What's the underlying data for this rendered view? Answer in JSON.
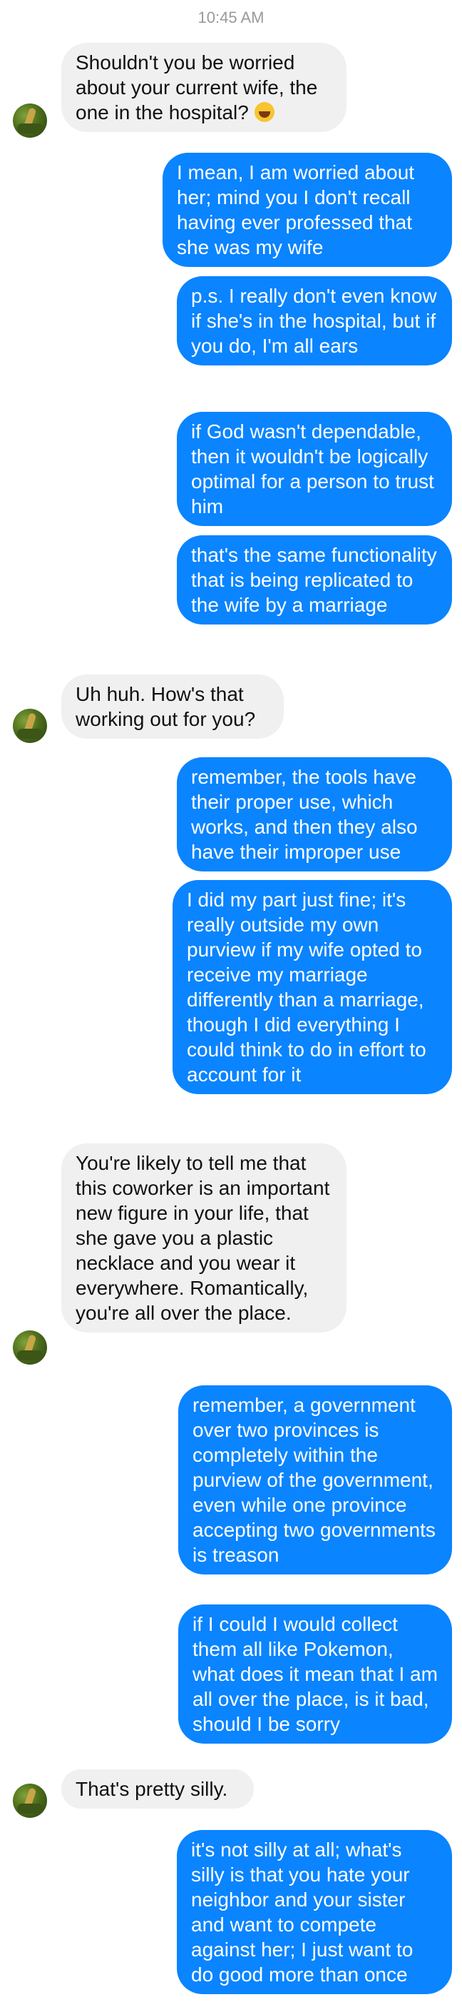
{
  "timestamp": "10:45 AM",
  "messages": [
    {
      "text": "Shouldn't you be worried about your current wife, the one in the hospital?",
      "emoji": "laughing-face-emoji"
    },
    {
      "text": "I mean, I am worried about her; mind you I don't recall having ever professed that she was my wife"
    },
    {
      "text": "p.s. I really don't even know if she's in the hospital, but if you do, I'm all ears"
    },
    {
      "text": "if God wasn't dependable, then it wouldn't be logically optimal for a person to trust him"
    },
    {
      "text": "that's the same functionality that is being replicated to the wife by a marriage"
    },
    {
      "text": "Uh huh. How's that working out for you?"
    },
    {
      "text": "remember, the tools have their proper use, which works, and then they also have their improper use"
    },
    {
      "text": "I did my part just fine; it's really outside my own purview if my wife opted to receive my marriage differently than a marriage, though I did everything I could think to do in effort to account for it"
    },
    {
      "text": "You're likely to tell me that this coworker is an important new figure in your life, that she gave you a plastic necklace and you wear it everywhere. Romantically, you're all over the place."
    },
    {
      "text": "remember, a government over two provinces is completely within the purview of the government, even while one province accepting two governments is treason"
    },
    {
      "text": "if I could I would collect them all like Pokemon, what does it mean that I am all over the place, is it bad, should I be sorry"
    },
    {
      "text": "That's pretty silly."
    },
    {
      "text": "it's not silly at all; what's silly is that you hate your neighbor and your sister and want to compete against her; I just want to do good more than once"
    }
  ],
  "colors": {
    "outgoing_bubble": "#0a84ff",
    "incoming_bubble": "#f0f0f0",
    "timestamp": "#9a9a9a"
  }
}
